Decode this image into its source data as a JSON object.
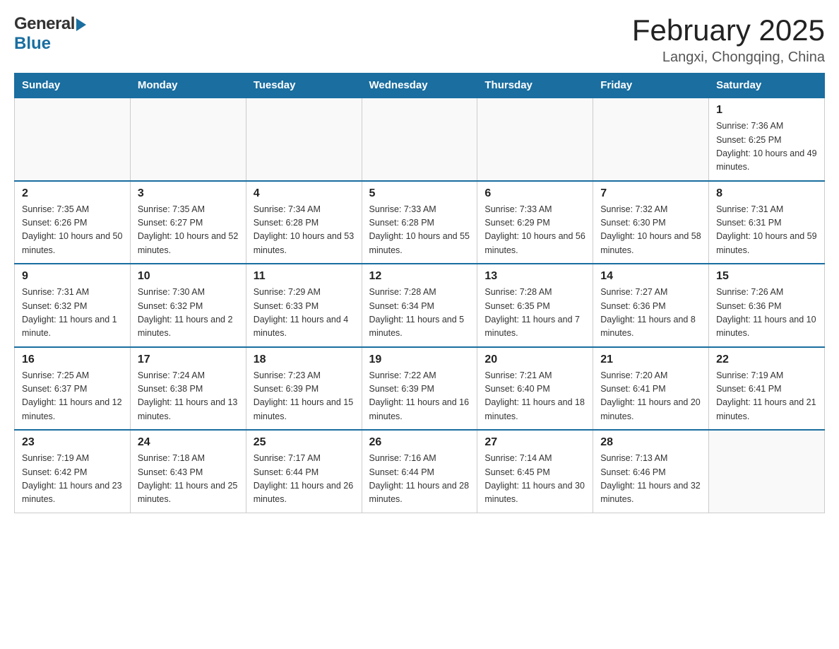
{
  "header": {
    "logo_general": "General",
    "logo_blue": "Blue",
    "main_title": "February 2025",
    "subtitle": "Langxi, Chongqing, China"
  },
  "calendar": {
    "days_of_week": [
      "Sunday",
      "Monday",
      "Tuesday",
      "Wednesday",
      "Thursday",
      "Friday",
      "Saturday"
    ],
    "weeks": [
      [
        {
          "day": "",
          "info": ""
        },
        {
          "day": "",
          "info": ""
        },
        {
          "day": "",
          "info": ""
        },
        {
          "day": "",
          "info": ""
        },
        {
          "day": "",
          "info": ""
        },
        {
          "day": "",
          "info": ""
        },
        {
          "day": "1",
          "info": "Sunrise: 7:36 AM\nSunset: 6:25 PM\nDaylight: 10 hours and 49 minutes."
        }
      ],
      [
        {
          "day": "2",
          "info": "Sunrise: 7:35 AM\nSunset: 6:26 PM\nDaylight: 10 hours and 50 minutes."
        },
        {
          "day": "3",
          "info": "Sunrise: 7:35 AM\nSunset: 6:27 PM\nDaylight: 10 hours and 52 minutes."
        },
        {
          "day": "4",
          "info": "Sunrise: 7:34 AM\nSunset: 6:28 PM\nDaylight: 10 hours and 53 minutes."
        },
        {
          "day": "5",
          "info": "Sunrise: 7:33 AM\nSunset: 6:28 PM\nDaylight: 10 hours and 55 minutes."
        },
        {
          "day": "6",
          "info": "Sunrise: 7:33 AM\nSunset: 6:29 PM\nDaylight: 10 hours and 56 minutes."
        },
        {
          "day": "7",
          "info": "Sunrise: 7:32 AM\nSunset: 6:30 PM\nDaylight: 10 hours and 58 minutes."
        },
        {
          "day": "8",
          "info": "Sunrise: 7:31 AM\nSunset: 6:31 PM\nDaylight: 10 hours and 59 minutes."
        }
      ],
      [
        {
          "day": "9",
          "info": "Sunrise: 7:31 AM\nSunset: 6:32 PM\nDaylight: 11 hours and 1 minute."
        },
        {
          "day": "10",
          "info": "Sunrise: 7:30 AM\nSunset: 6:32 PM\nDaylight: 11 hours and 2 minutes."
        },
        {
          "day": "11",
          "info": "Sunrise: 7:29 AM\nSunset: 6:33 PM\nDaylight: 11 hours and 4 minutes."
        },
        {
          "day": "12",
          "info": "Sunrise: 7:28 AM\nSunset: 6:34 PM\nDaylight: 11 hours and 5 minutes."
        },
        {
          "day": "13",
          "info": "Sunrise: 7:28 AM\nSunset: 6:35 PM\nDaylight: 11 hours and 7 minutes."
        },
        {
          "day": "14",
          "info": "Sunrise: 7:27 AM\nSunset: 6:36 PM\nDaylight: 11 hours and 8 minutes."
        },
        {
          "day": "15",
          "info": "Sunrise: 7:26 AM\nSunset: 6:36 PM\nDaylight: 11 hours and 10 minutes."
        }
      ],
      [
        {
          "day": "16",
          "info": "Sunrise: 7:25 AM\nSunset: 6:37 PM\nDaylight: 11 hours and 12 minutes."
        },
        {
          "day": "17",
          "info": "Sunrise: 7:24 AM\nSunset: 6:38 PM\nDaylight: 11 hours and 13 minutes."
        },
        {
          "day": "18",
          "info": "Sunrise: 7:23 AM\nSunset: 6:39 PM\nDaylight: 11 hours and 15 minutes."
        },
        {
          "day": "19",
          "info": "Sunrise: 7:22 AM\nSunset: 6:39 PM\nDaylight: 11 hours and 16 minutes."
        },
        {
          "day": "20",
          "info": "Sunrise: 7:21 AM\nSunset: 6:40 PM\nDaylight: 11 hours and 18 minutes."
        },
        {
          "day": "21",
          "info": "Sunrise: 7:20 AM\nSunset: 6:41 PM\nDaylight: 11 hours and 20 minutes."
        },
        {
          "day": "22",
          "info": "Sunrise: 7:19 AM\nSunset: 6:41 PM\nDaylight: 11 hours and 21 minutes."
        }
      ],
      [
        {
          "day": "23",
          "info": "Sunrise: 7:19 AM\nSunset: 6:42 PM\nDaylight: 11 hours and 23 minutes."
        },
        {
          "day": "24",
          "info": "Sunrise: 7:18 AM\nSunset: 6:43 PM\nDaylight: 11 hours and 25 minutes."
        },
        {
          "day": "25",
          "info": "Sunrise: 7:17 AM\nSunset: 6:44 PM\nDaylight: 11 hours and 26 minutes."
        },
        {
          "day": "26",
          "info": "Sunrise: 7:16 AM\nSunset: 6:44 PM\nDaylight: 11 hours and 28 minutes."
        },
        {
          "day": "27",
          "info": "Sunrise: 7:14 AM\nSunset: 6:45 PM\nDaylight: 11 hours and 30 minutes."
        },
        {
          "day": "28",
          "info": "Sunrise: 7:13 AM\nSunset: 6:46 PM\nDaylight: 11 hours and 32 minutes."
        },
        {
          "day": "",
          "info": ""
        }
      ]
    ]
  }
}
